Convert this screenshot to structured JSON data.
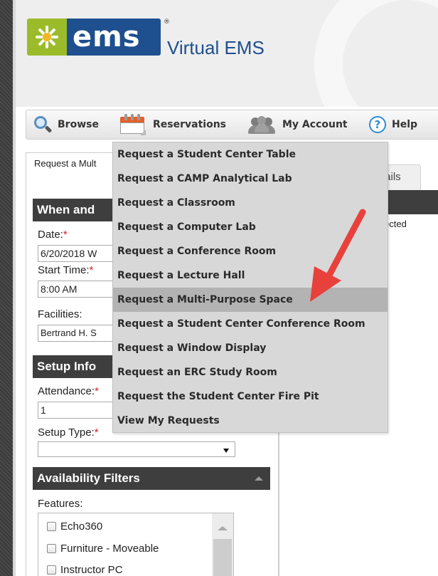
{
  "header": {
    "logo_text": "ems",
    "logo_reg": "®",
    "app_title": "Virtual EMS"
  },
  "nav": {
    "browse": "Browse",
    "reservations": "Reservations",
    "my_account": "My Account",
    "help": "Help",
    "help_glyph": "?"
  },
  "reservations_menu": {
    "items": [
      "Request a Student Center Table",
      "Request a CAMP Analytical Lab",
      "Request a Classroom",
      "Request a Computer Lab",
      "Request a Conference Room",
      "Request a Lecture Hall",
      "Request a Multi-Purpose Space",
      "Request a Student Center Conference Room",
      "Request a Window Display",
      "Request an ERC Study Room",
      "Request the Student Center Fire Pit",
      "View My Requests"
    ],
    "highlighted_item": "Request a Multi-Purpose Space"
  },
  "page": {
    "breadcrumb": "Request a Mult",
    "tab_details": "tails",
    "right_status": "ected"
  },
  "when": {
    "title": "When and",
    "date_label": "Date:",
    "date_value": "6/20/2018 W",
    "start_label": "Start Time:",
    "start_value": "8:00 AM",
    "facilities_label": "Facilities:",
    "facilities_value": "Bertrand H. S"
  },
  "setup": {
    "title": "Setup Info",
    "attendance_label": "Attendance:",
    "attendance_value": "1",
    "type_label": "Setup Type:",
    "type_value": ""
  },
  "availability": {
    "title": "Availability Filters",
    "features_label": "Features:",
    "features": [
      "Echo360",
      "Furniture - Moveable",
      "Instructor PC"
    ]
  },
  "required_marker": "*",
  "colors": {
    "brand_blue": "#1e4f8e",
    "brand_green": "#9bbb2b",
    "panel_header": "#3e3e3e",
    "menu_bg": "#d8d8d8",
    "menu_highlight": "#b3b3b3",
    "annotation_red": "#e8413c"
  }
}
